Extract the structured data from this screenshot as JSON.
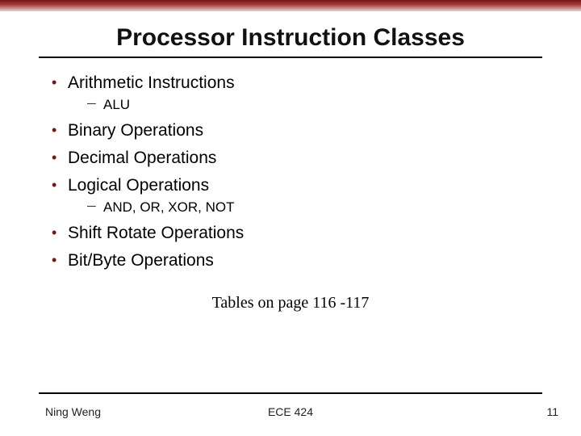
{
  "title": "Processor Instruction Classes",
  "bullets": {
    "b0": "Arithmetic Instructions",
    "b0_sub0": "ALU",
    "b1": "Binary Operations",
    "b2": "Decimal Operations",
    "b3": "Logical Operations",
    "b3_sub0": "AND, OR, XOR, NOT",
    "b4": "Shift Rotate Operations",
    "b5": "Bit/Byte Operations"
  },
  "note": "Tables on page 116 -117",
  "footer": {
    "left": "Ning Weng",
    "center": "ECE 424",
    "right": "11"
  },
  "colors": {
    "accent": "#7a1414"
  }
}
